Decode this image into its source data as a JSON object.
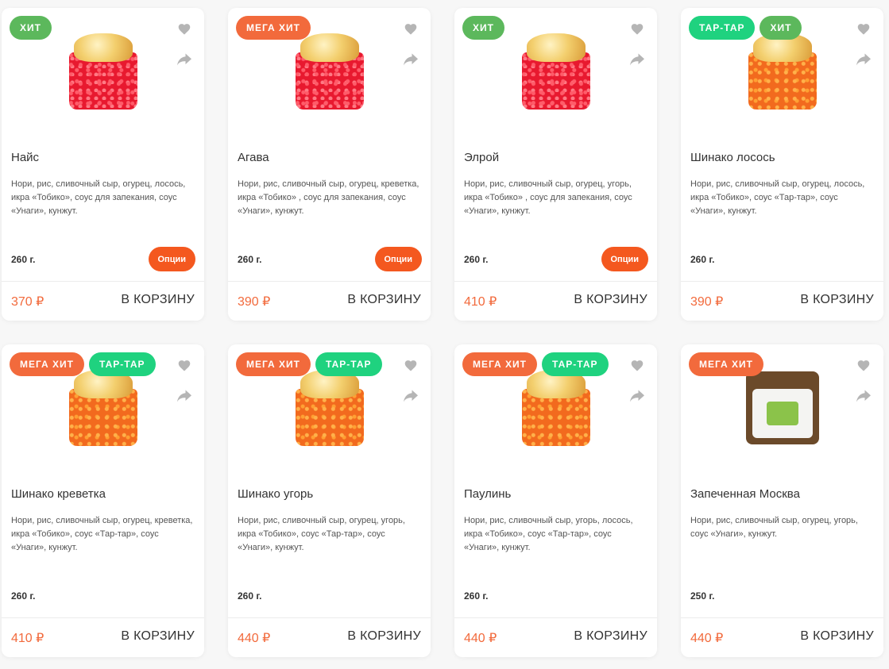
{
  "colors": {
    "accent": "#f26a3c",
    "options_button": "#f4581f",
    "badge_hit": "#5cb85c",
    "badge_mega": "#f26a3c",
    "badge_tartar": "#1fd27f",
    "icon_gray": "#b5b5b5"
  },
  "cart_label": "В КОРЗИНУ",
  "options_label": "Опции",
  "products": [
    {
      "badges": [
        {
          "label": "ХИТ",
          "type": "hit"
        }
      ],
      "title": "Найс",
      "description": "Нори, рис, сливочный сыр, огурец, лосось, икра «Тобико», соус для запекания, соус «Унаги», кунжут.",
      "weight": "260 г.",
      "price": "370 ₽",
      "has_options": true,
      "image": "roll-red"
    },
    {
      "badges": [
        {
          "label": "МЕГА ХИТ",
          "type": "mega"
        }
      ],
      "title": "Агава",
      "description": "Нори, рис, сливочный сыр, огурец, креветка, икра «Тобико» , соус для запекания, соус «Унаги», кунжут.",
      "weight": "260 г.",
      "price": "390 ₽",
      "has_options": true,
      "image": "roll-red"
    },
    {
      "badges": [
        {
          "label": "ХИТ",
          "type": "hit"
        }
      ],
      "title": "Элрой",
      "description": "Нори, рис, сливочный сыр, огурец, угорь, икра «Тобико» , соус для запекания, соус «Унаги», кунжут.",
      "weight": "260 г.",
      "price": "410 ₽",
      "has_options": true,
      "image": "roll-red"
    },
    {
      "badges": [
        {
          "label": "ТАР-ТАР",
          "type": "tartar"
        },
        {
          "label": "ХИТ",
          "type": "hit"
        }
      ],
      "title": "Шинако лосось",
      "description": "Нори, рис, сливочный сыр, огурец, лосось, икра «Тобико», соус «Тар-тар», соус «Унаги», кунжут.",
      "weight": "260 г.",
      "price": "390 ₽",
      "has_options": false,
      "image": "roll-orange"
    },
    {
      "badges": [
        {
          "label": "МЕГА ХИТ",
          "type": "mega"
        },
        {
          "label": "ТАР-ТАР",
          "type": "tartar"
        }
      ],
      "title": "Шинако креветка",
      "description": "Нори, рис, сливочный сыр, огурец, креветка, икра «Тобико», соус «Тар-тар», соус «Унаги», кунжут.",
      "weight": "260 г.",
      "price": "410 ₽",
      "has_options": false,
      "image": "roll-orange"
    },
    {
      "badges": [
        {
          "label": "МЕГА ХИТ",
          "type": "mega"
        },
        {
          "label": "ТАР-ТАР",
          "type": "tartar"
        }
      ],
      "title": "Шинако угорь",
      "description": "Нори, рис, сливочный сыр, огурец, угорь, икра «Тобико», соус «Тар-тар», соус «Унаги», кунжут.",
      "weight": "260 г.",
      "price": "440 ₽",
      "has_options": false,
      "image": "roll-orange"
    },
    {
      "badges": [
        {
          "label": "МЕГА ХИТ",
          "type": "mega"
        },
        {
          "label": "ТАР-ТАР",
          "type": "tartar"
        }
      ],
      "title": "Паулинь",
      "description": "Нори, рис, сливочный сыр, угорь, лосось, икра «Тобико», соус «Тар-тар», соус «Унаги», кунжут.",
      "weight": "260 г.",
      "price": "440 ₽",
      "has_options": false,
      "image": "roll-orange"
    },
    {
      "badges": [
        {
          "label": "МЕГА ХИТ",
          "type": "mega"
        }
      ],
      "title": "Запеченная Москва",
      "description": "Нори, рис, сливочный сыр, огурец, угорь, соус «Унаги», кунжут.",
      "weight": "250 г.",
      "price": "440 ₽",
      "has_options": false,
      "image": "roll-moscow"
    }
  ]
}
